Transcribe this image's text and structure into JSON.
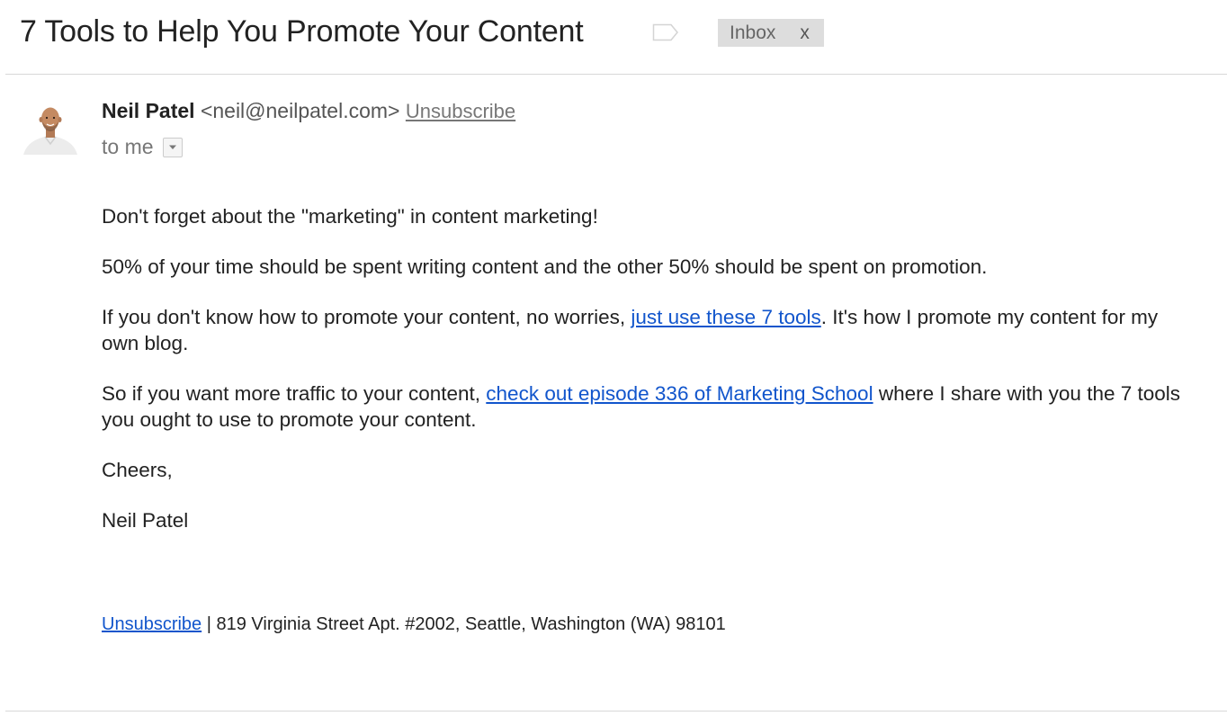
{
  "email": {
    "subject": "7 Tools to Help You Promote Your Content",
    "label": "Inbox",
    "label_remove": "x",
    "sender": {
      "name": "Neil Patel",
      "email": "<neil@neilpatel.com>",
      "unsubscribe": "Unsubscribe"
    },
    "recipient": "to me",
    "body": {
      "p1": "Don't forget about the \"marketing\" in content marketing!",
      "p2": "50% of your time should be spent writing content and the other 50% should be spent on promotion.",
      "p3_before": "If you don't know how to promote your content, no worries, ",
      "p3_link": "just use these 7 tools",
      "p3_after": ". It's how I promote my content for my own blog.",
      "p4_before": "So if you want more traffic to your content, ",
      "p4_link": "check out episode 336 of Marketing School",
      "p4_after": " where I share with you the 7 tools you ought to use to promote your content.",
      "closing": "Cheers,",
      "signature": "Neil Patel"
    },
    "footer": {
      "unsubscribe": "Unsubscribe",
      "address": " | 819 Virginia Street Apt. #2002, Seattle, Washington (WA) 98101"
    }
  },
  "colors": {
    "link": "#1155cc",
    "label_bg": "#dddddd",
    "muted": "#777777"
  },
  "icons": [
    "label-tag-icon",
    "avatar",
    "chevron-down-icon"
  ]
}
